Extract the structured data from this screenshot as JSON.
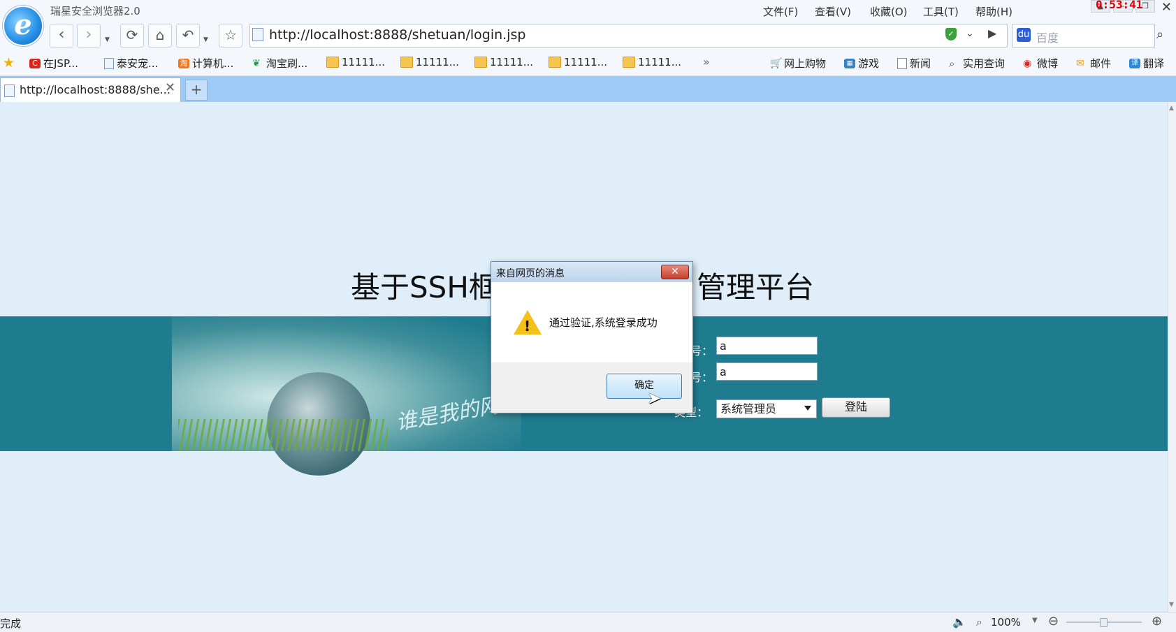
{
  "browser": {
    "app_title": "瑞星安全浏览器2.0",
    "menu": [
      "文件(F)",
      "查看(V)",
      "收藏(O)",
      "工具(T)",
      "帮助(H)"
    ],
    "clock": "0:53:41",
    "url": "http://localhost:8888/shetuan/login.jsp",
    "search_placeholder": "百度",
    "favorites": [
      {
        "label": "在JSP...",
        "icon": "c-red-icon"
      },
      {
        "label": "泰安宠...",
        "icon": "page-icon"
      },
      {
        "label": "计算机...",
        "icon": "taobao-icon"
      },
      {
        "label": "淘宝刷...",
        "icon": "bird-icon"
      },
      {
        "label": "11111...",
        "icon": "folder-icon"
      },
      {
        "label": "11111...",
        "icon": "folder-icon"
      },
      {
        "label": "11111...",
        "icon": "folder-icon"
      },
      {
        "label": "11111...",
        "icon": "folder-icon"
      },
      {
        "label": "11111...",
        "icon": "folder-icon"
      }
    ],
    "quick_links": [
      {
        "label": "网上购物",
        "icon": "cart-icon"
      },
      {
        "label": "游戏",
        "icon": "game-icon"
      },
      {
        "label": "新闻",
        "icon": "news-icon"
      },
      {
        "label": "实用查询",
        "icon": "search-icon"
      },
      {
        "label": "微博",
        "icon": "weibo-icon"
      },
      {
        "label": "邮件",
        "icon": "mail-icon"
      },
      {
        "label": "翻译",
        "icon": "translate-icon"
      }
    ],
    "tab": {
      "title": "http://localhost:8888/she..."
    }
  },
  "page": {
    "heading_left": "基于SSH框",
    "heading_right": "管理平台",
    "username_label": "号：",
    "password_label": "号：",
    "type_label": "类型：",
    "username_value": "a",
    "password_value": "a",
    "type_value": "系统管理员",
    "login_button": "登陆",
    "banner_script": "谁是我的网络"
  },
  "dialog": {
    "title": "来自网页的消息",
    "message": "通过验证,系统登录成功",
    "ok_label": "确定"
  },
  "status": {
    "text": "完成",
    "zoom": "100%"
  },
  "colors": {
    "page_bg": "#dfeef8",
    "banner_bg": "#1f7c8f",
    "tabbar_bg": "#9ccbf7",
    "clock_red": "#e00000"
  }
}
